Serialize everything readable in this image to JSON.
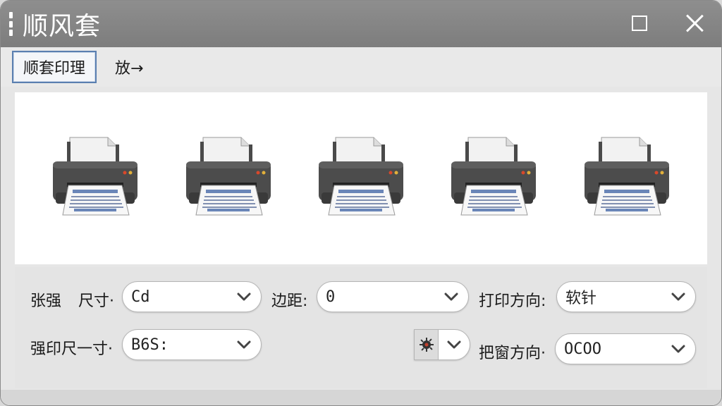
{
  "window": {
    "title": "顺风套"
  },
  "toolbar": {
    "tabs": [
      {
        "label": "顺套印理",
        "active": true
      },
      {
        "label": "放→",
        "active": false
      }
    ]
  },
  "preview": {
    "printer_count": 5,
    "icon": "printer-icon"
  },
  "settings": {
    "paper_label": "张强",
    "size_label": "尺寸·",
    "size_value": "Cd",
    "margin_label": "边距:",
    "margin_value": "0",
    "orientation_label": "打印方向:",
    "orientation_value": "软针",
    "print_size_label": "强印尺一寸·",
    "print_size_value": "B6S:",
    "window_direction_label": "把窗方向·",
    "window_direction_value": "OCOO",
    "color_icon": "color-gear-icon"
  },
  "colors": {
    "titlebar": "#858585",
    "accent_border": "#5a7fb0",
    "preview_bg": "#ffffff"
  }
}
